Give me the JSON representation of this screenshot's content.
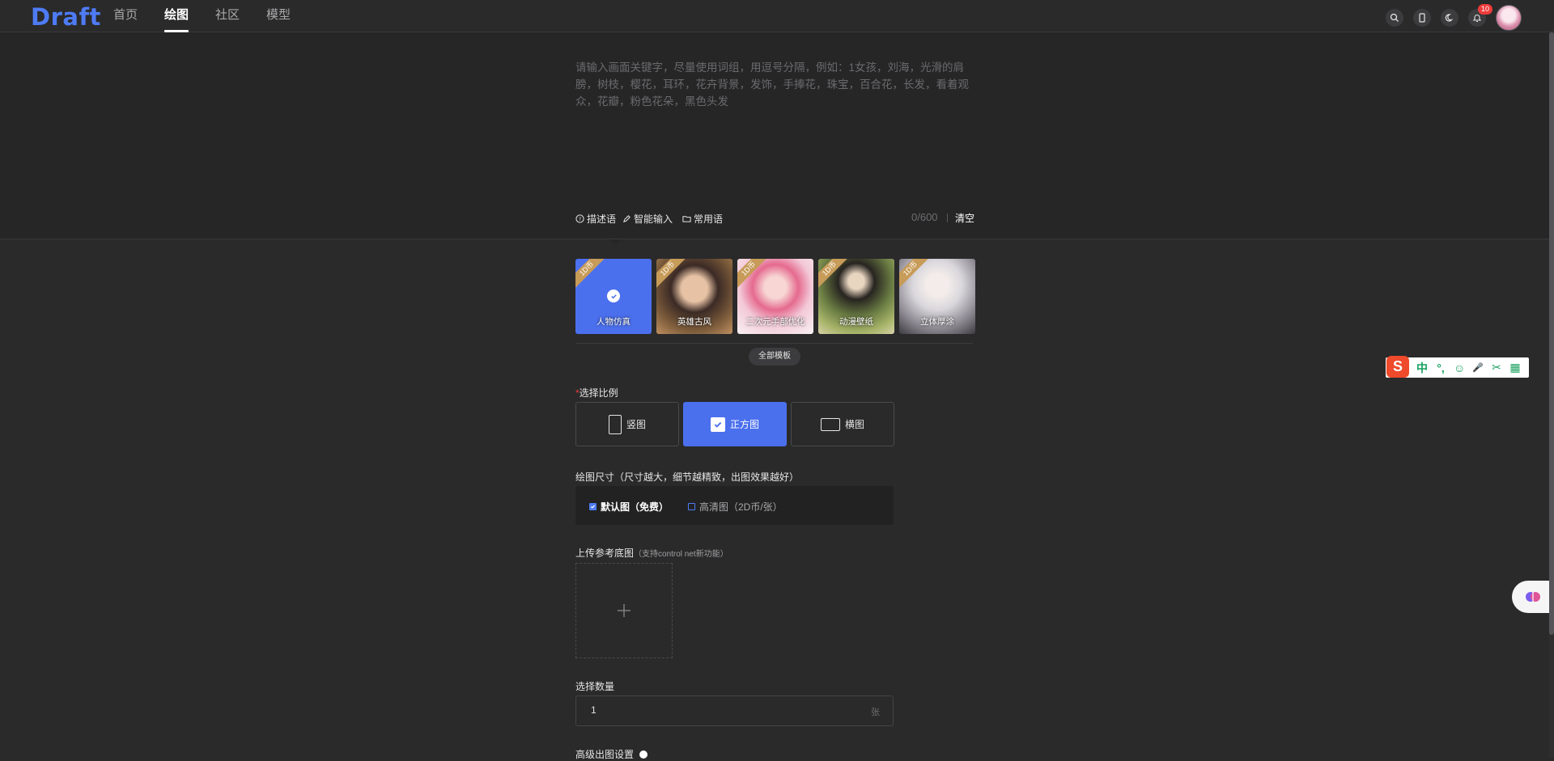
{
  "brand": {
    "logo": "Draft",
    "accent": "#4e7bf5"
  },
  "nav": {
    "items": [
      {
        "label": "首页"
      },
      {
        "label": "绘图",
        "active": true
      },
      {
        "label": "社区"
      },
      {
        "label": "模型"
      }
    ]
  },
  "header_icons": {
    "notification_count": "10"
  },
  "prompt": {
    "placeholder": "请输入画面关键字，尽量使用词组，用逗号分隔，例如：1女孩，刘海，光滑的肩膀，树枝，樱花，耳环，花卉背景，发饰，手捧花，珠宝，百合花，长发，看着观众，花瓣，粉色花朵，黑色头发",
    "tools": [
      {
        "label": "描述语",
        "icon": "question-circle-icon"
      },
      {
        "label": "智能输入",
        "icon": "pen-icon"
      },
      {
        "label": "常用语",
        "icon": "folder-icon"
      }
    ],
    "counter": "0/600",
    "clear_label": "清空"
  },
  "templates": {
    "items": [
      {
        "name": "人物仿真",
        "badge": "1D币",
        "selected": true
      },
      {
        "name": "英雄古风",
        "badge": "1D币"
      },
      {
        "name": "二次元手部优化",
        "badge": "1D币"
      },
      {
        "name": "动漫壁纸",
        "badge": "1D币"
      },
      {
        "name": "立体厚涂",
        "badge": "1D币"
      }
    ],
    "all_label": "全部模板"
  },
  "ratio": {
    "required_mark": "*",
    "label": "选择比例",
    "options": [
      {
        "label": "竖图"
      },
      {
        "label": "正方图",
        "selected": true
      },
      {
        "label": "横图"
      }
    ]
  },
  "size": {
    "label": "绘图尺寸（尺寸越大，细节越精致，出图效果越好）",
    "default_option": "默认图（免费）",
    "hd_option": "高清图（2D币/张）"
  },
  "upload": {
    "label": "上传参考底图",
    "sub_label": "（支持control net新功能）"
  },
  "count": {
    "label": "选择数量",
    "value": "1",
    "unit": "张"
  },
  "advanced": {
    "label": "高级出图设置"
  },
  "ime": {
    "logo": "S",
    "items": [
      "中",
      "°,",
      "☺",
      "🎤",
      "✂",
      "▦"
    ]
  }
}
